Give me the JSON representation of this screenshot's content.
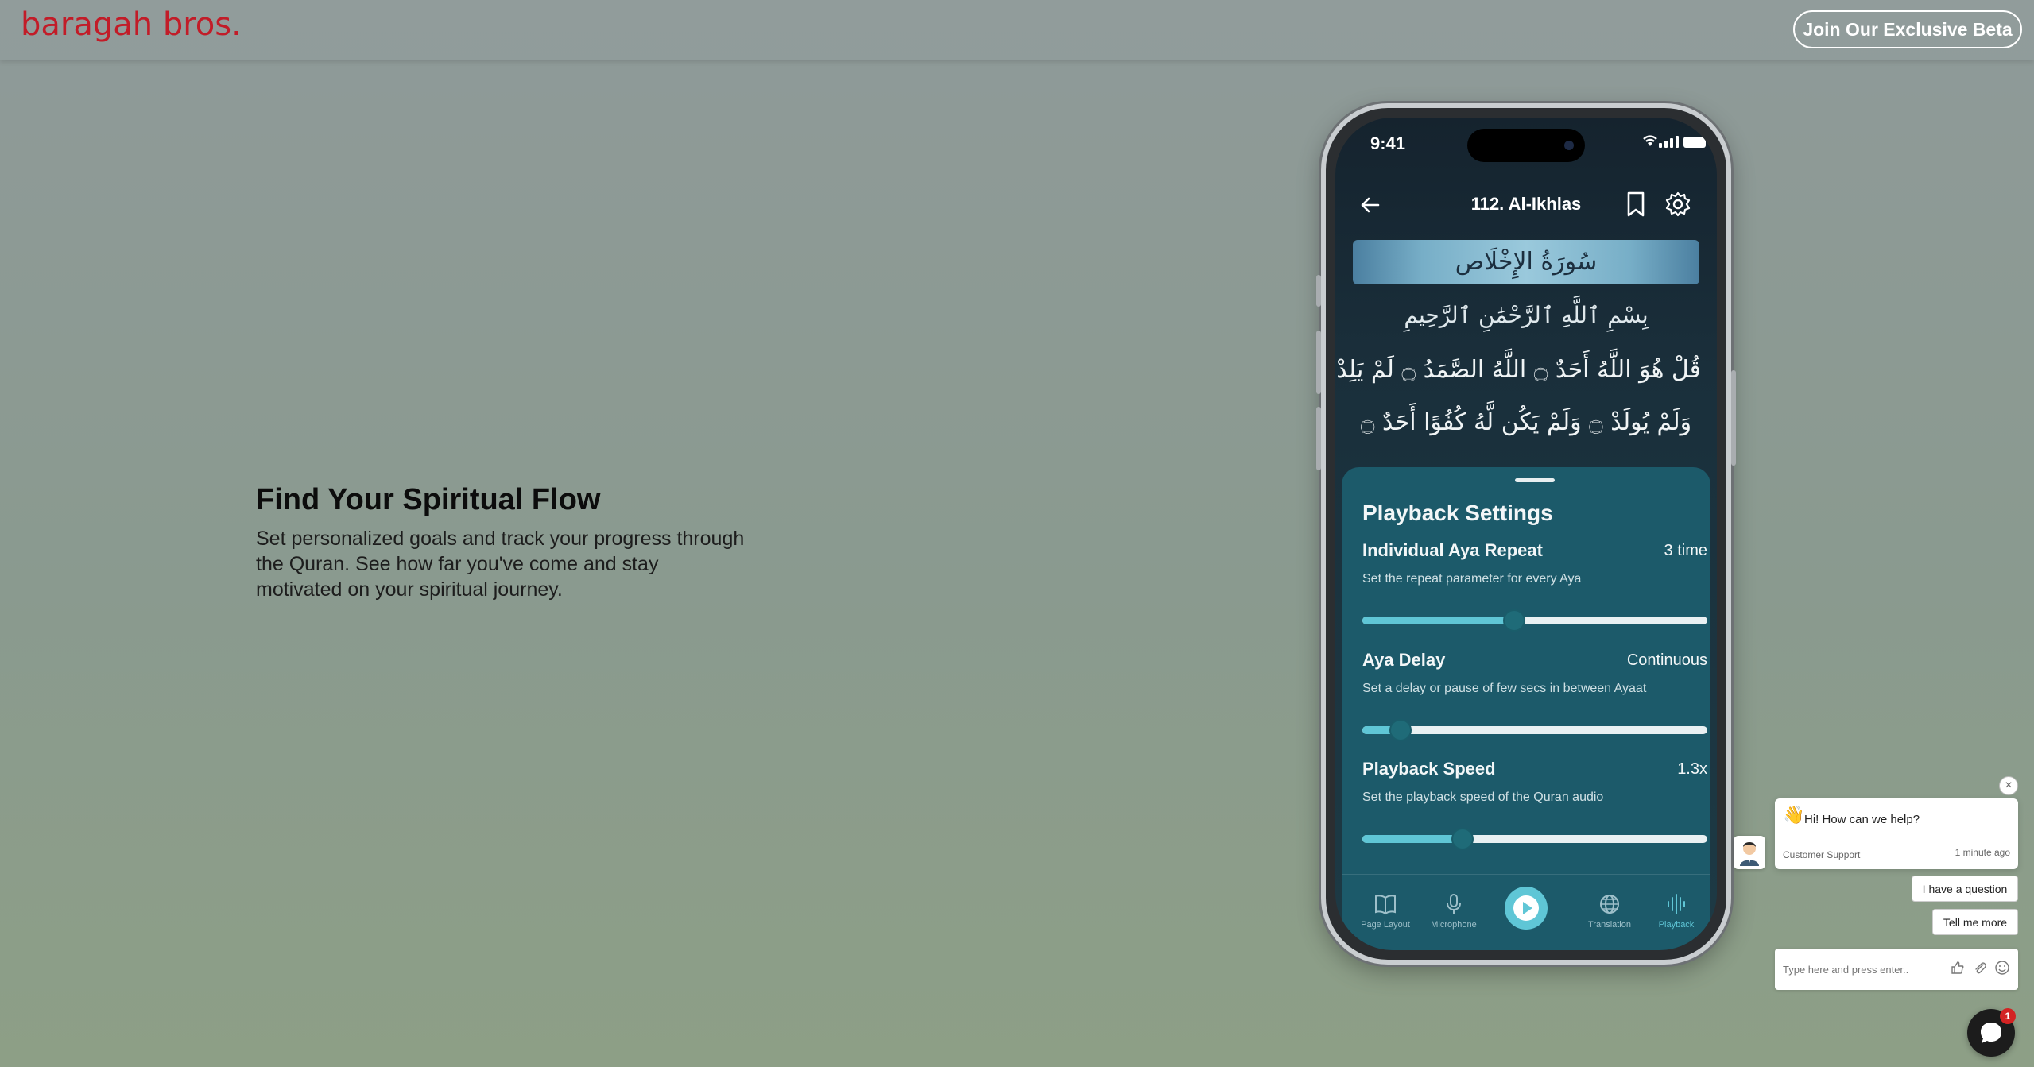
{
  "header": {
    "logo_text": "baragah bros.",
    "beta_button": "Join Our Exclusive Beta"
  },
  "hero": {
    "title": "Find Your Spiritual Flow",
    "subtitle": "Set personalized goals and track your progress through the Quran. See how far you've come and stay motivated on your spiritual journey."
  },
  "phone": {
    "status_time": "9:41",
    "nav_title": "112. Al-Ikhlas",
    "surah_banner": "سُورَةُ الإِخْلَاص",
    "bismillah": "بِسْمِ ٱللَّهِ ٱلرَّحْمَٰنِ ٱلرَّحِيمِ",
    "ayah_line_1": "قُلْ هُوَ اللَّهُ أَحَدٌ ۝ اللَّهُ الصَّمَدُ ۝ لَمْ يَلِدْ",
    "ayah_line_2": "وَلَمْ يُولَدْ ۝ وَلَمْ يَكُن لَّهُ كُفُوًا أَحَدٌ ۝",
    "sheet": {
      "title": "Playback Settings",
      "settings": [
        {
          "label": "Individual Aya Repeat",
          "value": "3 time",
          "desc": "Set the repeat parameter for every Aya",
          "level": 0.44
        },
        {
          "label": "Aya Delay",
          "value": "Continuous",
          "desc": "Set a delay or pause of few secs in between Ayaat",
          "level": 0.11
        },
        {
          "label": "Playback Speed",
          "value": "1.3x",
          "desc": "Set the playback speed of the Quran audio",
          "level": 0.29
        }
      ]
    },
    "tabs": [
      {
        "label": "Page Layout",
        "icon": "book-icon"
      },
      {
        "label": "Microphone",
        "icon": "microphone-icon"
      },
      {
        "label": "",
        "icon": "play-icon"
      },
      {
        "label": "Translation",
        "icon": "globe-icon"
      },
      {
        "label": "Playback",
        "icon": "waveform-icon"
      }
    ]
  },
  "chat": {
    "message": "Hi! How can we help?",
    "from": "Customer Support",
    "time": "1 minute ago",
    "options": [
      "I have a question",
      "Tell me more"
    ],
    "input_placeholder": "Type here and press enter..",
    "badge_count": "1"
  },
  "colors": {
    "brand_red": "#c21c28",
    "sheet_bg": "#1c5a6a",
    "accent_teal": "#5fc6d6"
  }
}
